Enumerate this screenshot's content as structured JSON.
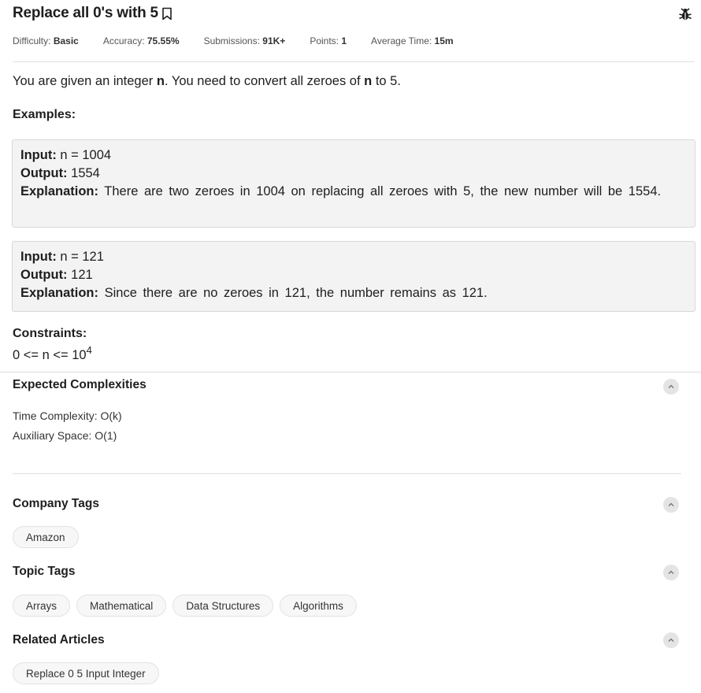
{
  "problem": {
    "title": "Replace all 0's with 5",
    "meta": [
      {
        "label": "Difficulty:",
        "value": "Basic"
      },
      {
        "label": "Accuracy:",
        "value": "75.55%"
      },
      {
        "label": "Submissions:",
        "value": "91K+"
      },
      {
        "label": "Points:",
        "value": "1"
      },
      {
        "label": "Average Time:",
        "value": "15m"
      }
    ],
    "statement": {
      "part1": "You are given an integer ",
      "bold1": "n",
      "part2": ". You need to convert all zeroes of ",
      "bold2": "n",
      "part3": " to 5."
    },
    "examples_heading": "Examples:",
    "examples": [
      {
        "input_label": "Input:",
        "input": " n = 1004",
        "output_label": "Output:",
        "output": " 1554",
        "explanation_label": "Explanation:",
        "explanation": " There are two zeroes in 1004 on replacing all zeroes with 5, the new number will be 1554."
      },
      {
        "input_label": "Input:",
        "input": " n = 121",
        "output_label": "Output:",
        "output": " 121",
        "explanation_label": "Explanation:",
        "explanation": " Since there are no zeroes in 121, the number remains as 121."
      }
    ],
    "constraints_heading": "Constraints:",
    "constraint_base": "0 <= n <= 10",
    "constraint_exp": "4"
  },
  "complexities": {
    "heading": "Expected Complexities",
    "time": "Time Complexity: O(k)",
    "space": "Auxiliary Space: O(1)"
  },
  "company_tags": {
    "heading": "Company Tags",
    "tags": [
      "Amazon"
    ]
  },
  "topic_tags": {
    "heading": "Topic Tags",
    "tags": [
      "Arrays",
      "Mathematical",
      "Data Structures",
      "Algorithms"
    ]
  },
  "related_articles": {
    "heading": "Related Articles",
    "tags": [
      "Replace 0 5 Input Integer"
    ]
  },
  "icons": {
    "bookmark": "bookmark-icon",
    "bug": "bug-report-icon",
    "collapse": "chevron-up-icon"
  }
}
